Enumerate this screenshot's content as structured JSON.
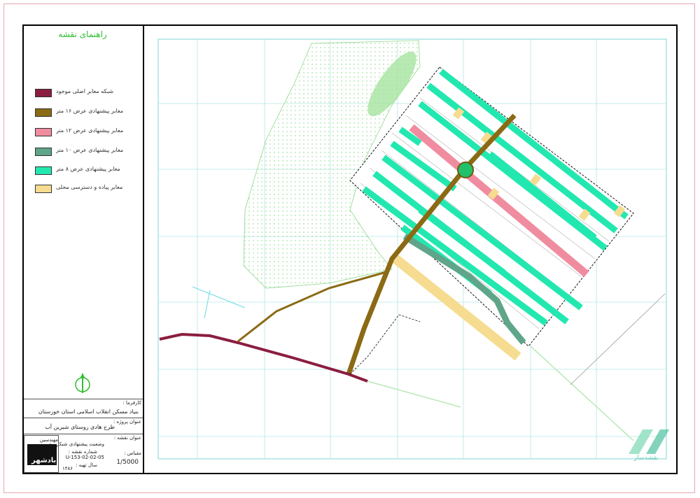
{
  "header": {
    "legend_title": "راهنمای نقشه"
  },
  "legend": [
    {
      "label": "شبکه معابر اصلی موجود",
      "color": "#8b1d3f"
    },
    {
      "label": "معابر پیشنهادی عرض ۱۶ متر",
      "color": "#8b6a14"
    },
    {
      "label": "معابر پیشنهادی عرض ۱۲ متر",
      "color": "#f08ca0"
    },
    {
      "label": "معابر پیشنهادی عرض ۱۰ متر",
      "color": "#5fa58a"
    },
    {
      "label": "معابر پیشنهادی عرض ۸ متر",
      "color": "#22e8b0"
    },
    {
      "label": "معابر پیاده و دسترسی محلی",
      "color": "#f6dc90"
    }
  ],
  "title_block": {
    "client_label": "کارفرما :",
    "client_value": "بنیاد مسکن انقلاب اسلامی استان خوزستان",
    "project_label": "عنوان پروژه :",
    "project_value": "طرح هادی روستای شیرین آب",
    "map_title_label": "عنوان نقشه :",
    "map_title_value": "وضعیت پیشنهادی شبکه معابر",
    "scale_label": "مقیاس :",
    "scale_value": "1/5000",
    "map_number_label": "شماره نقشه :",
    "map_number_value": "U-153-02-02-05",
    "year_label": "سال تهیه :",
    "year_value": "۱۳۸۶",
    "consultant_top": "مهندسین مشاور",
    "consultant_name": "بادشهر"
  },
  "watermark": {
    "text": "نقشه‌ساز"
  },
  "colors": {
    "road_main": "#8b1d3f",
    "road_16": "#8b6a14",
    "road_12": "#f08ca0",
    "road_10": "#5fa58a",
    "road_8": "#22e8b0",
    "pedestrian": "#f6dc90",
    "grid": "#9be0e0",
    "green_area": "#a6e3a0"
  }
}
